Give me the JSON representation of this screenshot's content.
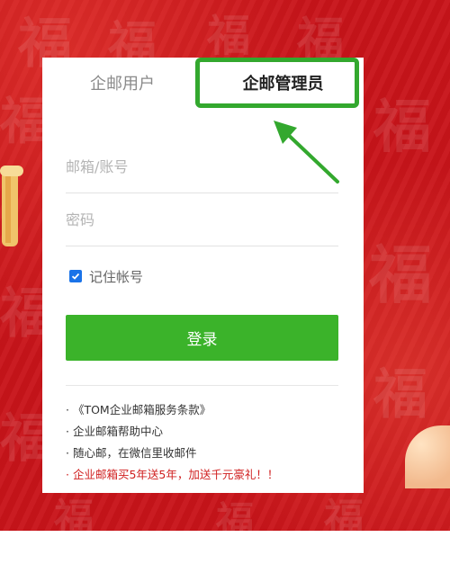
{
  "tabs": {
    "user_label": "企邮用户",
    "admin_label": "企邮管理员"
  },
  "form": {
    "email_placeholder": "邮箱/账号",
    "password_placeholder": "密码",
    "remember_label": "记住帐号",
    "remember_checked": true,
    "login_label": "登录"
  },
  "links": [
    {
      "text": "· 《TOM企业邮箱服务条款》"
    },
    {
      "text": "· 企业邮箱帮助中心"
    },
    {
      "text": "· 随心邮，在微信里收邮件"
    },
    {
      "text": "· 企业邮箱买5年送5年，加送千元豪礼！！"
    }
  ],
  "colors": {
    "background_red": "#c8141a",
    "login_button": "#3bb32a",
    "highlight_green": "#33a82e",
    "promo_text": "#d02020",
    "checkbox_blue": "#1a73e8"
  },
  "icons": {
    "arrow": "arrow-pointer-icon",
    "checkbox": "checkmark-icon"
  }
}
